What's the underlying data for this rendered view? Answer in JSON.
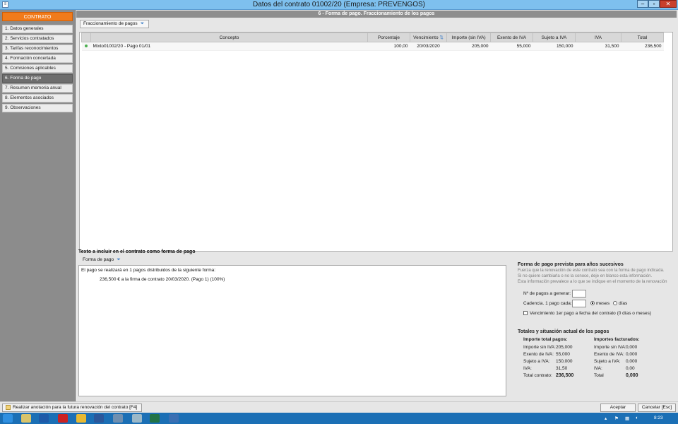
{
  "window": {
    "title": "Datos del contrato 01002/20  (Empresa: PREVENGOS)",
    "app_icon": "app-icon",
    "controls": {
      "minimize": "–",
      "maximize": "▫",
      "close": "✕"
    }
  },
  "sidebar": {
    "header": "CONTRATO",
    "items": [
      {
        "label": "1. Datos generales"
      },
      {
        "label": "2. Servicios contratados"
      },
      {
        "label": "3. Tarifas reconocimientos"
      },
      {
        "label": "4. Formación concertada"
      },
      {
        "label": "5. Comisiones aplicables"
      },
      {
        "label": "6. Forma de pago"
      },
      {
        "label": "7. Resumen memoria anual"
      },
      {
        "label": "8. Elementos asociados"
      },
      {
        "label": "9. Observaciones"
      }
    ],
    "active_index": 5
  },
  "main": {
    "section_title": "6 - Forma de pago. Fraccionamiento de los pagos",
    "split_dropdown": "Fraccionamiento de pagos",
    "table": {
      "columns": [
        "",
        "Concepto",
        "Porcentaje",
        "Vencimiento",
        "Importe (sin IVA)",
        "Exento de IVA",
        "Sujeto a IVA",
        "IVA",
        "Total"
      ],
      "rows": [
        [
          "",
          "Mixto01002/20 - Pago 01/01",
          "100,00",
          "20/03/2020",
          "205,000",
          "55,000",
          "150,000",
          "31,500",
          "236,500"
        ]
      ]
    }
  },
  "contract_text": {
    "label": "Texto a incluir en el contrato como forma de pago",
    "dropdown": "Forma de pago",
    "line1": "El pago se realizará en 1 pagos distribuidos de la siguiente forma:",
    "line2": "236,500 € a la firma de contrato 20/03/2020. (Pago 1) (100%)"
  },
  "future_payment": {
    "title": "Forma de pago prevista para años sucesivos",
    "help1": "Fuerza que la renovación de este contrato sea con la forma de pago indicada.",
    "help2": "Si no quiere cambiarla o no la conoce, deje en blanco esta información.",
    "help3": "Esta información prevalece a lo que se indique en el momento de la renovación",
    "num_payments_label": "Nº de pagos a generar:",
    "num_payments_value": "",
    "cadence_label": "Cadencia. 1 pago cada:",
    "cadence_value": "",
    "unit_meses": "meses",
    "unit_dias": "días",
    "unit_selected": "meses",
    "first_payment_check_label": "Vencimiento 1er pago a fecha del contrato (0 días o meses)",
    "first_payment_checked": false
  },
  "totals": {
    "title": "Totales y situación actual de los pagos",
    "col1_title": "Importe total pagos:",
    "col2_title": "Importes facturados:",
    "col1": [
      {
        "label": "Importe sin IVA:",
        "value": "205,000"
      },
      {
        "label": "Exento de IVA:",
        "value": "55,000"
      },
      {
        "label": "Sujeto a IVA:",
        "value": "150,000"
      },
      {
        "label": "IVA:",
        "value": "31,50"
      },
      {
        "label": "Total contrato:",
        "value": "236,500"
      }
    ],
    "col2": [
      {
        "label": "Importe sin IVA:",
        "value": "0,000"
      },
      {
        "label": "Exento de IVA:",
        "value": "0,000"
      },
      {
        "label": "Sujeto a IVA:",
        "value": "0,000"
      },
      {
        "label": "IVA:",
        "value": "0,00"
      },
      {
        "label": "Total",
        "value": "0,000"
      }
    ]
  },
  "buttons": {
    "renewal_note": "Realizar anotación para la futura renovación del contrato  [F4]",
    "accept": "Aceptar",
    "cancel": "Cancelar [Esc]"
  },
  "taskbar": {
    "clock": "8:23",
    "colors": {
      "bar": "#1b6fb5",
      "accent": "#f17b1b"
    }
  }
}
